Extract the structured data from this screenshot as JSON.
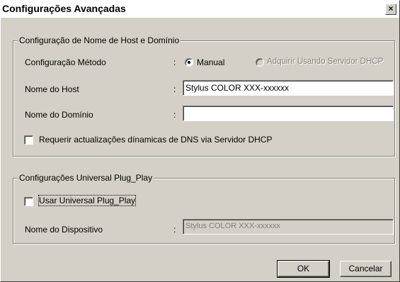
{
  "dialog": {
    "title": "Configurações Avançadas",
    "close_glyph": "×"
  },
  "host_group": {
    "legend": "Configuração de Nome de Host e Domínio",
    "method_label": "Configuração Método",
    "method_options": [
      "Manual",
      "Adquirir Usando Servidor DHCP"
    ],
    "method_selected": "Manual",
    "host_label": "Nome do Host",
    "host_value": "Stylus COLOR XXX-xxxxxx",
    "domain_label": "Nome do Domínio",
    "domain_value": "",
    "dns_checkbox_label": "Requerir actualizações dínamicas de DNS via Servidor DHCP",
    "dns_checked": false
  },
  "upnp_group": {
    "legend": "Configurações Universal Plug_Play",
    "use_checkbox_label": "Usar Universal Plug_Play",
    "use_checked": false,
    "device_label": "Nome do Dispositivo",
    "device_value": "Stylus COLOR XXX-xxxxxx"
  },
  "colon": ":",
  "buttons": {
    "ok": "OK",
    "cancel": "Cancelar"
  }
}
